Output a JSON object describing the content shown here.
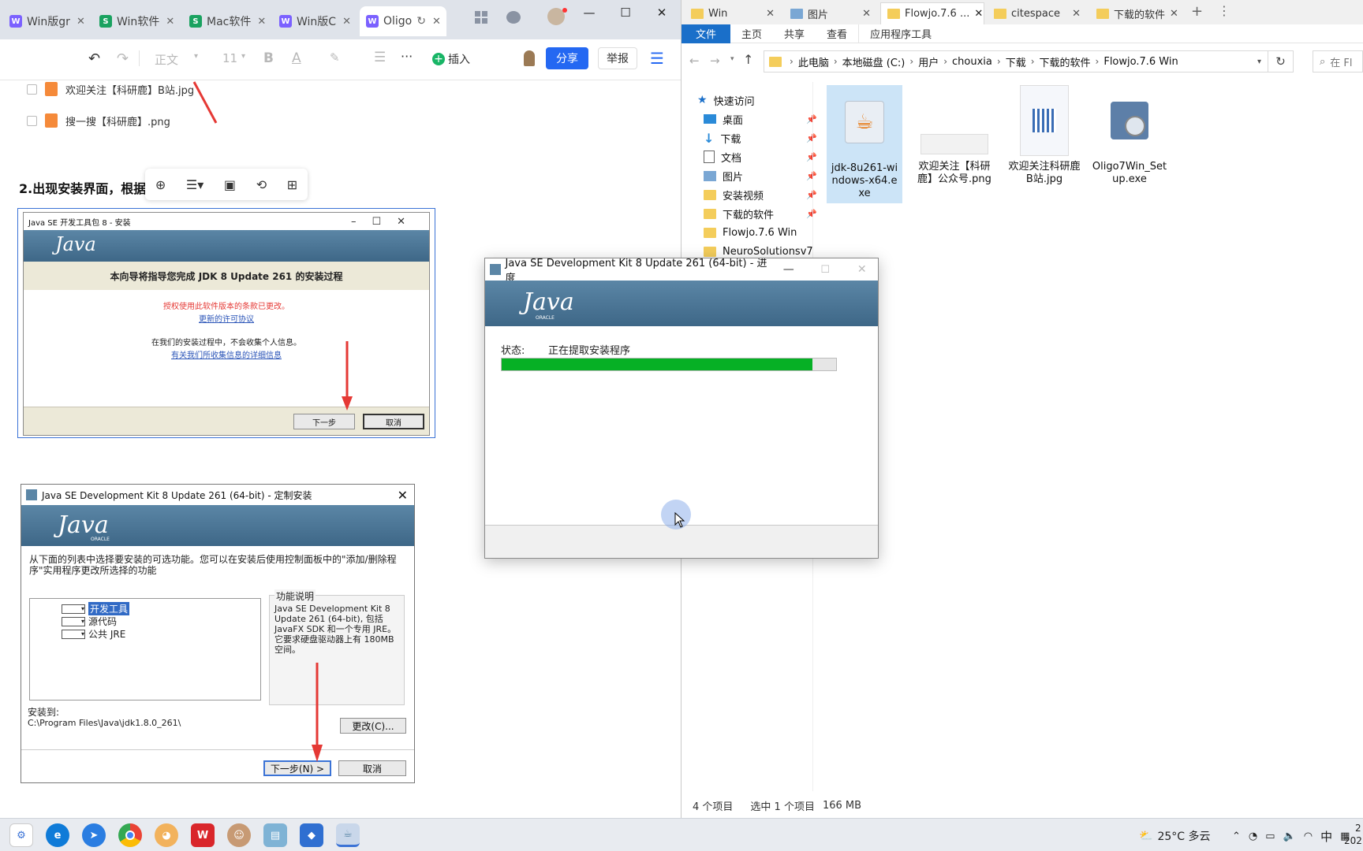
{
  "browser": {
    "tabs": [
      {
        "label": "Win版gr",
        "color": "#7b61ff",
        "glyph": "W"
      },
      {
        "label": "Win软件",
        "color": "#1aa260",
        "glyph": "S"
      },
      {
        "label": "Mac软件",
        "color": "#1aa260",
        "glyph": "S"
      },
      {
        "label": "Win版C",
        "color": "#7b61ff",
        "glyph": "W"
      },
      {
        "label": "Oligo",
        "color": "#7b61ff",
        "glyph": "W"
      }
    ],
    "toolbar": {
      "style_label": "正文",
      "font_size": "11",
      "bold": "B",
      "font_color": "A",
      "more": "···",
      "insert_label": "插入",
      "share_label": "分享",
      "report_label": "举报"
    },
    "doc": {
      "files": [
        "欢迎关注【科研鹿】B站.jpg",
        "搜一搜【科研鹿】.png"
      ],
      "heading": "2.出现安装界面，根据"
    },
    "setup_dialog": {
      "title": "Java SE 开发工具包 8 - 安装",
      "heading": "本向导将指导您完成 JDK 8 Update 261 的安装过程",
      "license_changed": "授权使用此软件版本的条款已更改。",
      "license_link": "更新的许可协议",
      "privacy_text": "在我们的安装过程中，不会收集个人信息。",
      "privacy_link": "有关我们所收集信息的详细信息",
      "next": "下一步",
      "cancel": "取消"
    },
    "custom_dialog": {
      "title": "Java SE Development Kit 8 Update 261 (64-bit) - 定制安装",
      "instruction": "从下面的列表中选择要安装的可选功能。您可以在安装后使用控制面板中的\"添加/删除程序\"实用程序更改所选择的功能",
      "features": [
        "开发工具",
        "源代码",
        "公共 JRE"
      ],
      "desc_title": "功能说明",
      "desc_text": "Java SE Development Kit 8 Update 261 (64-bit), 包括 JavaFX SDK 和一个专用 JRE。它要求硬盘驱动器上有 180MB 空间。",
      "install_to_label": "安装到:",
      "install_path": "C:\\Program Files\\Java\\jdk1.8.0_261\\",
      "change_button": "更改(C)...",
      "next_button": "下一步(N) >",
      "cancel_button": "取消"
    },
    "java_logo": "Java",
    "oracle_label": "ORACLE"
  },
  "progress_dialog": {
    "title": "Java SE Development Kit 8 Update 261 (64-bit) - 进度",
    "status_label": "状态:",
    "status_text": "正在提取安装程序",
    "progress": 0.93
  },
  "explorer": {
    "tabs": [
      "Win",
      "图片",
      "Flowjo.7.6 ...",
      "citespace",
      "下载的软件"
    ],
    "ribbon": [
      "文件",
      "主页",
      "共享",
      "查看",
      "应用程序工具"
    ],
    "path": [
      "此电脑",
      "本地磁盘 (C:)",
      "用户",
      "chouxia",
      "下载",
      "下载的软件",
      "Flowjo.7.6 Win"
    ],
    "search_placeholder": "在 Fl",
    "nav": {
      "quick_access": "快速访问",
      "items": [
        "桌面",
        "下载",
        "文档",
        "图片",
        "安装视频",
        "下载的软件",
        "Flowjo.7.6 Win",
        "NeuroSolutionsv7.0"
      ]
    },
    "files": [
      {
        "name": "jdk-8u261-windows-x64.exe"
      },
      {
        "name": "欢迎关注【科研鹿】公众号.png"
      },
      {
        "name": "欢迎关注科研鹿B站.jpg"
      },
      {
        "name": "Oligo7Win_Setup.exe"
      }
    ],
    "status": {
      "count": "4 个项目",
      "selected": "选中 1 个项目",
      "size": "166 MB"
    }
  },
  "taskbar": {
    "weather": "25°C  多云",
    "ime": "中",
    "clock_top": "2",
    "clock_bottom": "202"
  }
}
